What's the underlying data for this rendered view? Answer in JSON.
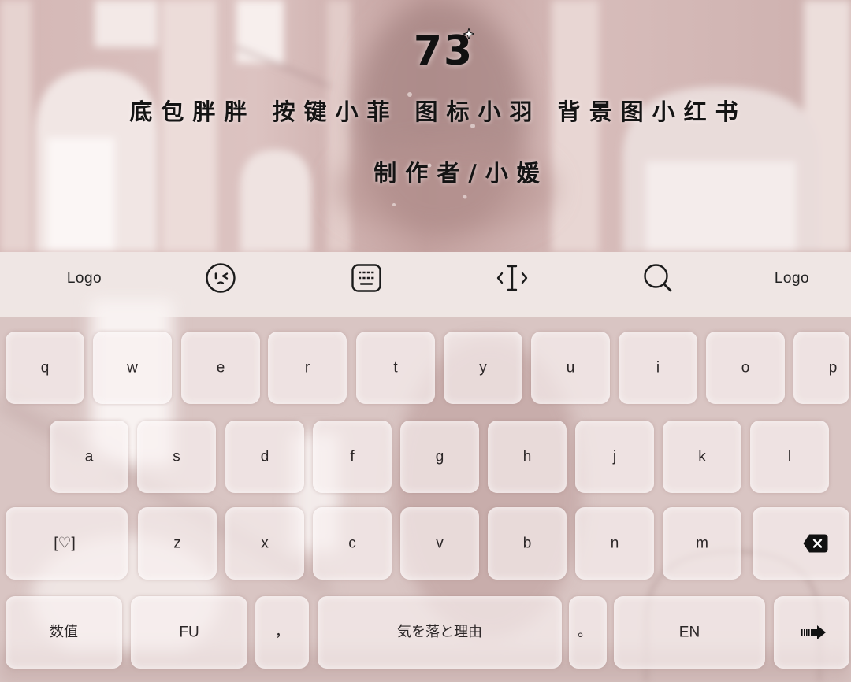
{
  "banner": {
    "number": "73",
    "credits": "底包胖胖 按键小菲 图标小羽 背景图小红书",
    "author": "制作者/小媛",
    "decoration_icon": "sparkle-icon"
  },
  "toolbar": {
    "left_logo": "Logo",
    "right_logo": "Logo",
    "icons": [
      "emoji-face-icon",
      "keyboard-icon",
      "text-cursor-icon",
      "search-icon"
    ]
  },
  "keyboard": {
    "rows": [
      {
        "keys": [
          {
            "label": "q"
          },
          {
            "label": "w"
          },
          {
            "label": "e"
          },
          {
            "label": "r"
          },
          {
            "label": "t"
          },
          {
            "label": "y"
          },
          {
            "label": "u"
          },
          {
            "label": "i"
          },
          {
            "label": "o"
          },
          {
            "label": "p"
          }
        ]
      },
      {
        "keys": [
          {
            "label": "a"
          },
          {
            "label": "s"
          },
          {
            "label": "d"
          },
          {
            "label": "f"
          },
          {
            "label": "g"
          },
          {
            "label": "h"
          },
          {
            "label": "j"
          },
          {
            "label": "k"
          },
          {
            "label": "l"
          }
        ]
      },
      {
        "keys": [
          {
            "label": "[♡]"
          },
          {
            "label": "z"
          },
          {
            "label": "x"
          },
          {
            "label": "c"
          },
          {
            "label": "v"
          },
          {
            "label": "b"
          },
          {
            "label": "n"
          },
          {
            "label": "m"
          },
          {
            "icon": "backspace-icon"
          }
        ]
      },
      {
        "keys": [
          {
            "label": "数值"
          },
          {
            "label": "FU"
          },
          {
            "label": "，"
          },
          {
            "label": "気を落と理由"
          },
          {
            "label": "。"
          },
          {
            "label": "EN"
          },
          {
            "icon": "enter-arrow-icon"
          }
        ]
      }
    ]
  },
  "colors": {
    "banner_text": "#111111",
    "key_label": "#2b2627",
    "banner_tint": "#d3b6b4",
    "keyboard_background": "#d9c5c3",
    "key_fill": "#f9f2f1",
    "icon_stroke": "#1a1a1a"
  }
}
